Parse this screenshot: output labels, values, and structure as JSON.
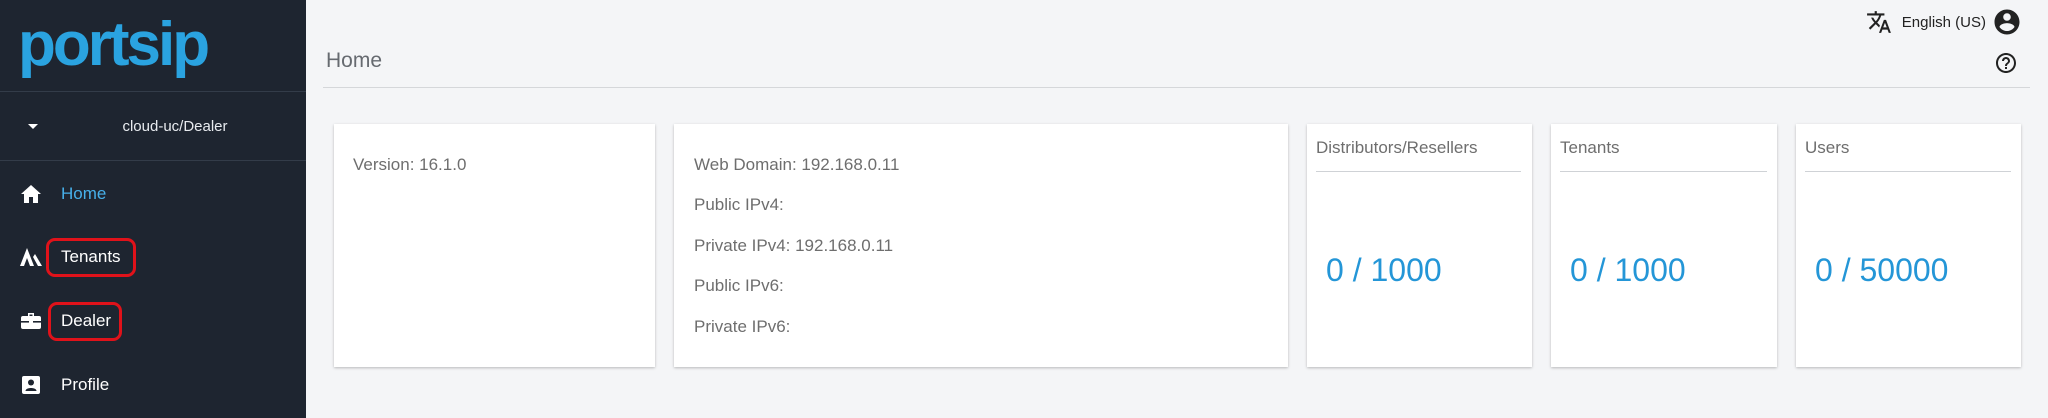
{
  "app": {
    "logo_text": "portsip"
  },
  "sidebar": {
    "account": "cloud-uc/Dealer",
    "items": [
      {
        "label": "Home",
        "icon": "home-icon",
        "active": true
      },
      {
        "label": "Tenants",
        "icon": "tenants-icon",
        "highlighted": true
      },
      {
        "label": "Dealer",
        "icon": "briefcase-icon",
        "highlighted": true
      },
      {
        "label": "Profile",
        "icon": "profile-icon"
      }
    ]
  },
  "header": {
    "language": "English (US)",
    "language_icon": "translate-icon",
    "account_icon": "account-circle-icon",
    "help_icon": "help-icon"
  },
  "page": {
    "title": "Home"
  },
  "cards": {
    "version": {
      "text": "Version: 16.1.0"
    },
    "network": {
      "web_domain": "Web Domain: 192.168.0.11",
      "public_ipv4": "Public IPv4:",
      "private_ipv4": "Private IPv4: 192.168.0.11",
      "public_ipv6": "Public IPv6:",
      "private_ipv6": "Private IPv6:"
    },
    "stats": [
      {
        "title": "Distributors/Resellers",
        "value": "0 / 1000"
      },
      {
        "title": "Tenants",
        "value": "0 / 1000"
      },
      {
        "title": "Users",
        "value": "0 / 50000"
      }
    ]
  },
  "colors": {
    "sidebar_bg": "#1e2530",
    "accent": "#2aa3e0",
    "stat_value": "#2496d7",
    "highlight": "#e0121a"
  }
}
